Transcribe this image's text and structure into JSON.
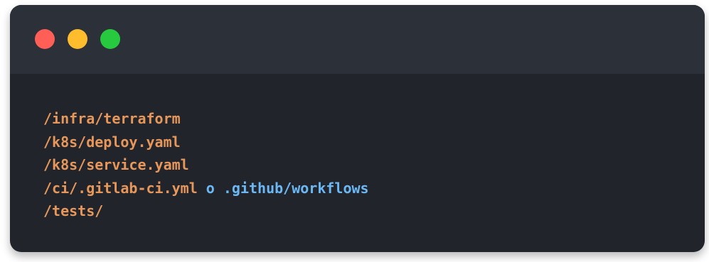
{
  "window": {
    "controls": [
      "close",
      "minimize",
      "maximize"
    ],
    "colors": {
      "background": "#21252b",
      "titlebar": "#2c3038",
      "close": "#ff5f56",
      "minimize": "#ffbd2e",
      "maximize": "#27c93f",
      "path_text": "#e8975a",
      "highlight_text": "#6cb8f5"
    }
  },
  "code": {
    "lines": [
      {
        "text": "/infra/terraform"
      },
      {
        "text": "/k8s/deploy.yaml"
      },
      {
        "text": "/k8s/service.yaml"
      },
      {
        "text": "/ci/.gitlab-ci.yml",
        "conjunction": "o",
        "alt": ".github/workflows"
      },
      {
        "text": "/tests/"
      }
    ]
  }
}
